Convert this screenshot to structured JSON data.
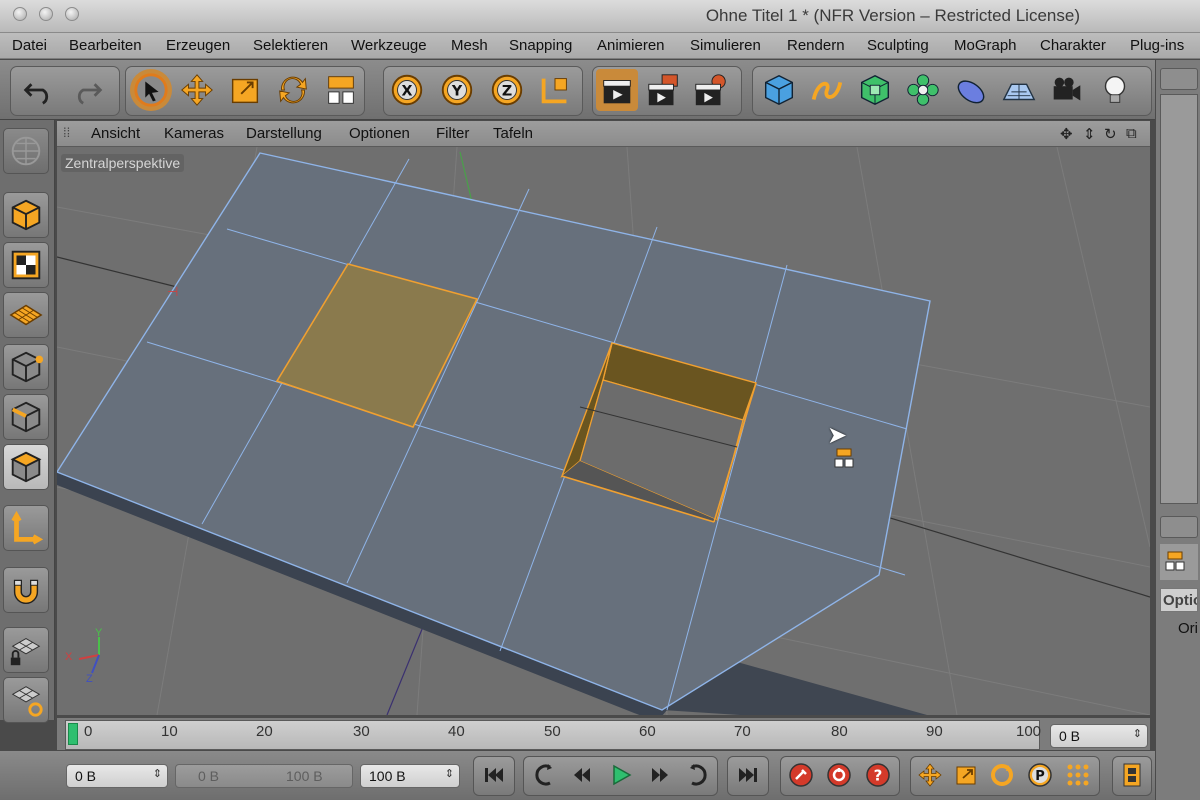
{
  "window": {
    "title": "Ohne Titel 1 * (NFR Version – Restricted License)"
  },
  "menu": {
    "items": [
      "Datei",
      "Bearbeiten",
      "Erzeugen",
      "Selektieren",
      "Werkzeuge",
      "Mesh",
      "Snapping",
      "Animieren",
      "Simulieren",
      "Rendern",
      "Sculpting",
      "MoGraph",
      "Charakter",
      "Plug-ins"
    ]
  },
  "viewport": {
    "menu": [
      "Ansicht",
      "Kameras",
      "Darstellung",
      "Optionen",
      "Filter",
      "Tafeln"
    ],
    "camera_label": "Zentralperspektive",
    "axis_labels": {
      "x": "X",
      "y": "Y",
      "z": "Z"
    }
  },
  "timeline": {
    "ticks": [
      "0",
      "10",
      "20",
      "30",
      "40",
      "50",
      "60",
      "70",
      "80",
      "90",
      "100"
    ],
    "current_frame": "0 B"
  },
  "playback": {
    "current": "0 B",
    "range_start": "0 B",
    "range_end": "100 B",
    "end": "100 B"
  },
  "right_panel": {
    "tab_label": "Optio",
    "field_label": "Ori"
  },
  "colors": {
    "accent": "#f5a623",
    "selection": "#f0a030",
    "wire": "#8fb4e8",
    "play_green": "#2fbf6f",
    "record_red": "#d43a2a"
  }
}
